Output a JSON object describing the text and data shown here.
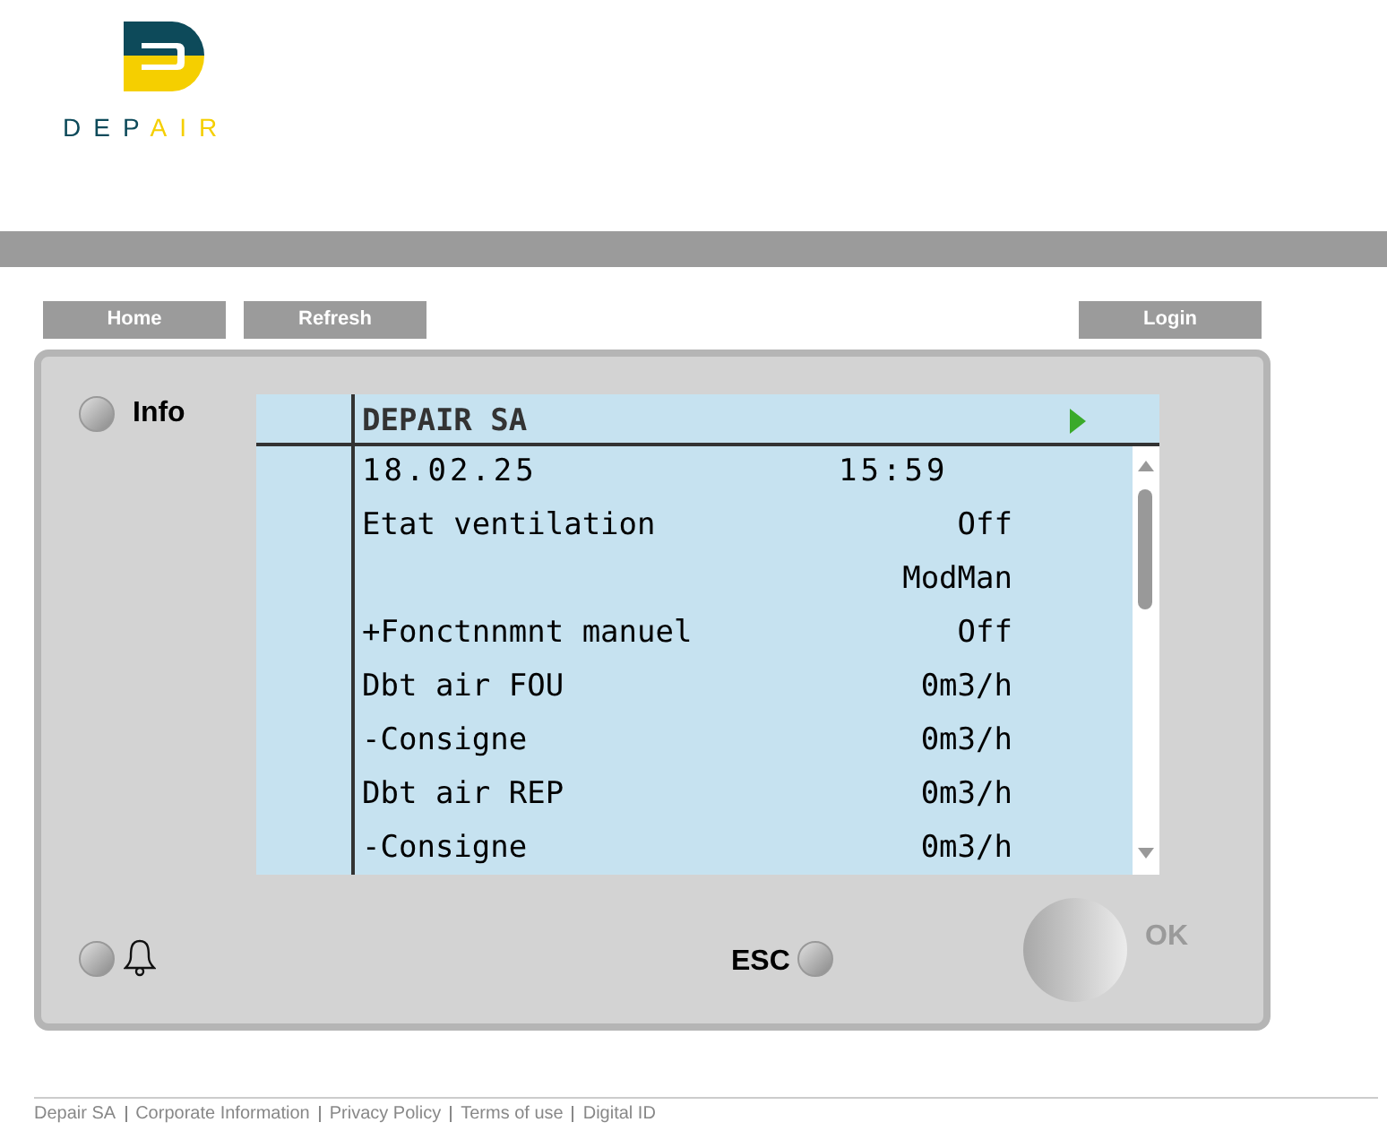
{
  "logo": {
    "text_dark": "DEP",
    "text_accent": "AIR"
  },
  "nav": {
    "left": [
      "Home",
      "Refresh"
    ],
    "right": [
      "Login"
    ]
  },
  "panel": {
    "info_label": "Info",
    "esc_label": "ESC",
    "ok_label": "OK"
  },
  "screen": {
    "title": "DEPAIR SA",
    "rows": [
      {
        "kind": "datetime",
        "label": "18.02.25",
        "value": "15:59"
      },
      {
        "kind": "param",
        "label": "Etat ventilation",
        "value": "Off"
      },
      {
        "kind": "param",
        "label": "",
        "value": "ModMan"
      },
      {
        "kind": "param",
        "label": "+Fonctnnmnt manuel",
        "value": "Off"
      },
      {
        "kind": "param",
        "label": "Dbt air FOU",
        "value": "0m3/h"
      },
      {
        "kind": "param",
        "label": "-Consigne",
        "value": "0m3/h"
      },
      {
        "kind": "param",
        "label": "Dbt air REP",
        "value": "0m3/h"
      },
      {
        "kind": "param",
        "label": "-Consigne",
        "value": "0m3/h"
      }
    ]
  },
  "footer": [
    "Depair SA",
    "Corporate Information",
    "Privacy Policy",
    "Terms of use",
    "Digital ID"
  ]
}
